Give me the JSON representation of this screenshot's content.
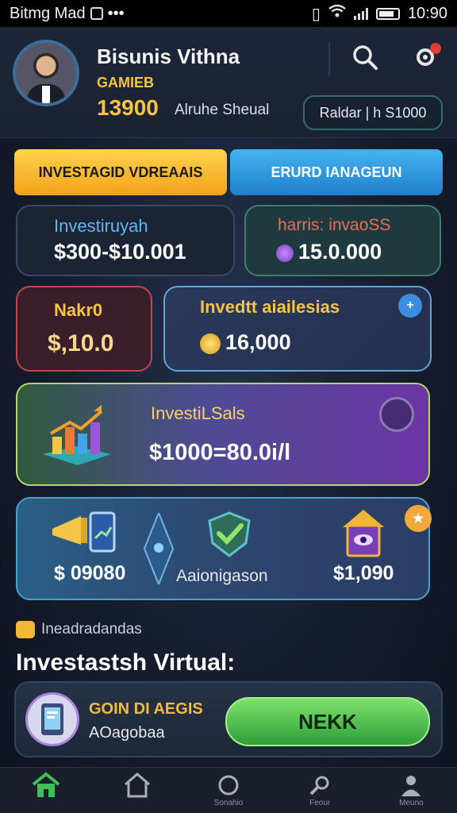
{
  "status_bar": {
    "carrier": "Bitmg Mad",
    "time": "10:90"
  },
  "profile": {
    "name": "Bisunis Vithna",
    "tier": "GAMIEB",
    "balance": "13900",
    "subtitle": "Alruhe Sheual",
    "balance_pill": "Raldar | h S1000"
  },
  "tabs": [
    {
      "label": "INVESTAGID VDREAAIS"
    },
    {
      "label": "ERURD IANAGEUN"
    }
  ],
  "cards": {
    "investment_range": {
      "label": "Investiruyah",
      "value": "$300-$10.001"
    },
    "harris": {
      "label": "harris: invaoSS",
      "value": "15.0.000"
    },
    "naku": {
      "label": "Nakr0",
      "value": "$,10.0"
    },
    "invest_available": {
      "label": "Invedtt aiailesias",
      "value": "16,000"
    },
    "invest_sals": {
      "label": "InvestiLSals",
      "value": "$1000=80.0i/l"
    },
    "bottom_row": {
      "left_value": "$ 09080",
      "middle_label": "Aaionigason",
      "right_value": "$1,090"
    }
  },
  "section": {
    "tag": "Ineadradandas",
    "title": "Investastsh Virtual:"
  },
  "promo": {
    "title": "GOIN DI AEGIS",
    "subtitle": "AOagobaa",
    "button": "NEKK"
  },
  "nav": [
    {
      "icon": "home-icon-active",
      "label": ""
    },
    {
      "icon": "home-outline-icon",
      "label": ""
    },
    {
      "icon": "circle-icon",
      "label": "Sonahio"
    },
    {
      "icon": "link-icon",
      "label": "Feour"
    },
    {
      "icon": "user-icon",
      "label": "Meuno"
    }
  ],
  "colors": {
    "accent_gold": "#f6c343",
    "accent_blue": "#1f7fcb",
    "accent_green": "#3aaa44"
  }
}
